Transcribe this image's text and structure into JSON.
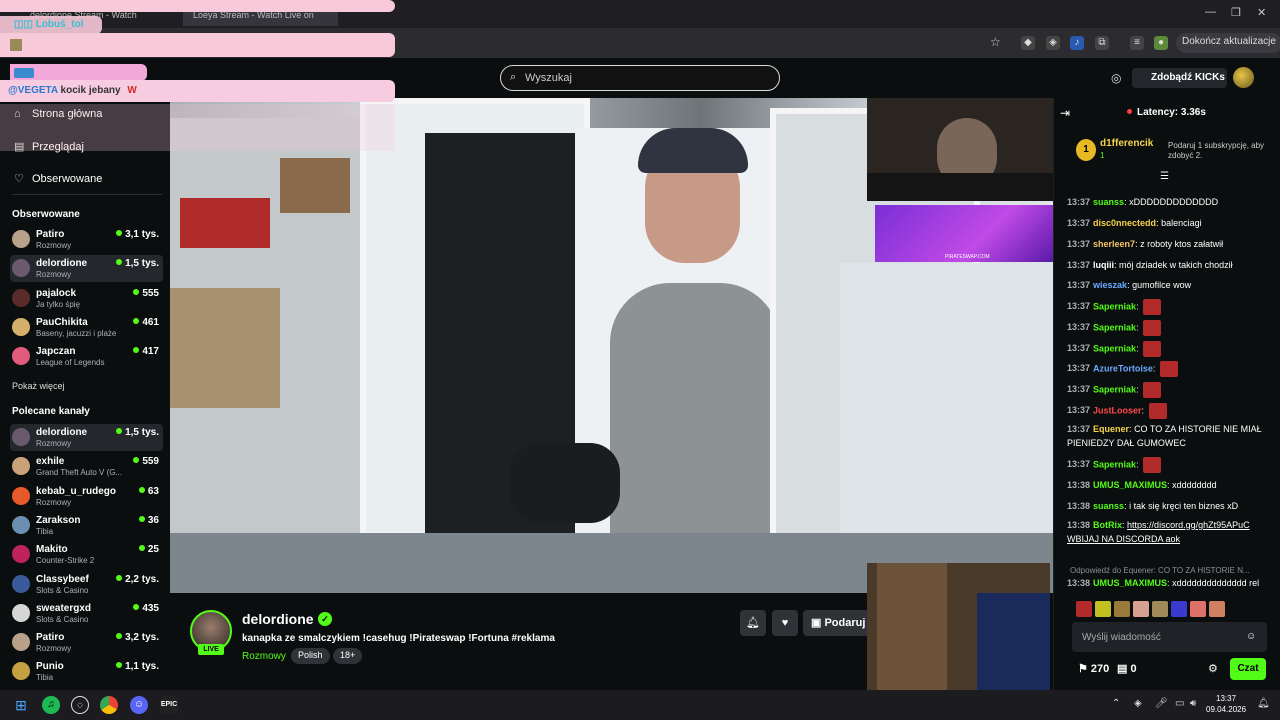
{
  "browser": {
    "tabs": [
      {
        "label": "delordione Stream - Watch"
      },
      {
        "label": "Loeya Stream - Watch Live on"
      }
    ],
    "update_button": "Dokończ aktualizacje"
  },
  "overlay": {
    "user1": "Lobuś_tol",
    "message_mention": "@VEGETA",
    "message_text": "kocik jebany",
    "message_suffix": "W"
  },
  "header": {
    "search_placeholder": "Wyszukaj",
    "kicks_button": "Zdobądź KICKs"
  },
  "sidebar": {
    "nav": [
      {
        "label": "Strona główna",
        "icon": "home-icon"
      },
      {
        "label": "Przeglądaj",
        "icon": "browse-icon"
      },
      {
        "label": "Obserwowane",
        "icon": "heart-icon"
      }
    ],
    "followed_title": "Obserwowane",
    "followed": [
      {
        "name": "Patiro",
        "category": "Rozmowy",
        "viewers": "3,1 tys.",
        "color": "#b9a089"
      },
      {
        "name": "delordione",
        "category": "Rozmowy",
        "viewers": "1,5 tys.",
        "color": "#6b5a6e"
      },
      {
        "name": "pajalock",
        "category": "Ja tylko śpię",
        "viewers": "555",
        "color": "#5a2b2b"
      },
      {
        "name": "PauChikita",
        "category": "Baseny, jacuzzi i plaże",
        "viewers": "461",
        "color": "#d4b06a"
      },
      {
        "name": "Japczan",
        "category": "League of Legends",
        "viewers": "417",
        "color": "#e05b7c"
      }
    ],
    "show_more": "Pokaż więcej",
    "recommended_title": "Polecane kanały",
    "recommended": [
      {
        "name": "delordione",
        "category": "Rozmowy",
        "viewers": "1,5 tys.",
        "color": "#6b5a6e"
      },
      {
        "name": "exhile",
        "category": "Grand Theft Auto V (G...",
        "viewers": "559",
        "color": "#c9a27a"
      },
      {
        "name": "kebab_u_rudego",
        "category": "Rozmowy",
        "viewers": "63",
        "color": "#e85a2a"
      },
      {
        "name": "Zarakson",
        "category": "Tibia",
        "viewers": "36",
        "color": "#6a8fb0"
      },
      {
        "name": "Makito",
        "category": "Counter-Strike 2",
        "viewers": "25",
        "color": "#c0235b"
      },
      {
        "name": "Classybeef",
        "category": "Slots & Casino",
        "viewers": "2,2 tys.",
        "color": "#3a5a9a"
      },
      {
        "name": "sweatergxd",
        "category": "Slots & Casino",
        "viewers": "435",
        "color": "#d6d6d6"
      },
      {
        "name": "Patiro",
        "category": "Rozmowy",
        "viewers": "3,2 tys.",
        "color": "#b9a089"
      },
      {
        "name": "Punio",
        "category": "Tibia",
        "viewers": "1,1 tys.",
        "color": "#c4a040"
      }
    ]
  },
  "video": {
    "banner_text": "PIRATESWAP.COM"
  },
  "stream": {
    "streamer": "delordione",
    "live": "LIVE",
    "title": "kanapka ze smalczykiem !casehug !Pirateswap !Fortuna #reklama",
    "category": "Rozmowy",
    "tags": [
      "Polish",
      "18+"
    ],
    "gift_button": "Podaruj"
  },
  "chat": {
    "latency": "Latency: 3.36s",
    "leader_rank": "1",
    "leader_name": "d1fferencik",
    "leader_count": "1",
    "sub_info": "Podaruj 1 subskrypcję, aby zdobyć 2.",
    "messages": [
      {
        "time": "13:37",
        "user": "suanss",
        "color": "#53fc18",
        "text": "xDDDDDDDDDDDDD"
      },
      {
        "time": "13:37",
        "user": "disc0nnectedd",
        "color": "#f7d44a",
        "text": "balenciagi"
      },
      {
        "time": "13:37",
        "user": "sherleen7",
        "color": "#f7c46a",
        "text": "z roboty ktos załatwił"
      },
      {
        "time": "13:37",
        "user": "luqiii",
        "color": "#ffffff",
        "text": "mój dziadek w takich chodził"
      },
      {
        "time": "13:37",
        "user": "wieszak",
        "color": "#6aa9ff",
        "text": "gumofilce wow"
      },
      {
        "time": "13:37",
        "user": "Saperniak",
        "color": "#53fc18",
        "text": ""
      },
      {
        "time": "13:37",
        "user": "Saperniak",
        "color": "#53fc18",
        "text": ""
      },
      {
        "time": "13:37",
        "user": "Saperniak",
        "color": "#53fc18",
        "text": ""
      },
      {
        "time": "13:37",
        "user": "AzureTortoise",
        "color": "#6aa9ff",
        "text": ""
      },
      {
        "time": "13:37",
        "user": "Saperniak",
        "color": "#53fc18",
        "text": ""
      },
      {
        "time": "13:37",
        "user": "JustLooser",
        "color": "#ff4a4a",
        "text": ""
      },
      {
        "time": "13:37",
        "user": "Equener",
        "color": "#f7d44a",
        "text": "CO TO ZA HISTORIE NIE MIAŁ PIENIEDZY DAŁ GUMOWEC"
      },
      {
        "time": "13:37",
        "user": "Saperniak",
        "color": "#53fc18",
        "text": ""
      },
      {
        "time": "13:38",
        "user": "UMUS_MAXIMUS",
        "color": "#53fc18",
        "text": "xdddddddd"
      },
      {
        "time": "13:38",
        "user": "suanss",
        "color": "#53fc18",
        "text": "i tak się kręci ten biznes xD"
      },
      {
        "time": "13:38",
        "user": "BotRix",
        "color": "#53fc18",
        "text": "https://discord.gg/ghZt95APuC WBIJAJ NA DISCORDA aok"
      },
      {
        "time": "13:38",
        "user": "UMUS_MAXIMUS",
        "color": "#53fc18",
        "text": "xdddddddddddddd rel"
      }
    ],
    "reply_hint": "Odpowiedź do Equener: CO TO ZA HISTORIE N...",
    "input_placeholder": "Wyślij wiadomość",
    "points": "270",
    "chests": "0",
    "send_button": "Czat"
  },
  "taskbar": {
    "time": "13:37",
    "date": "09.04.2026"
  }
}
